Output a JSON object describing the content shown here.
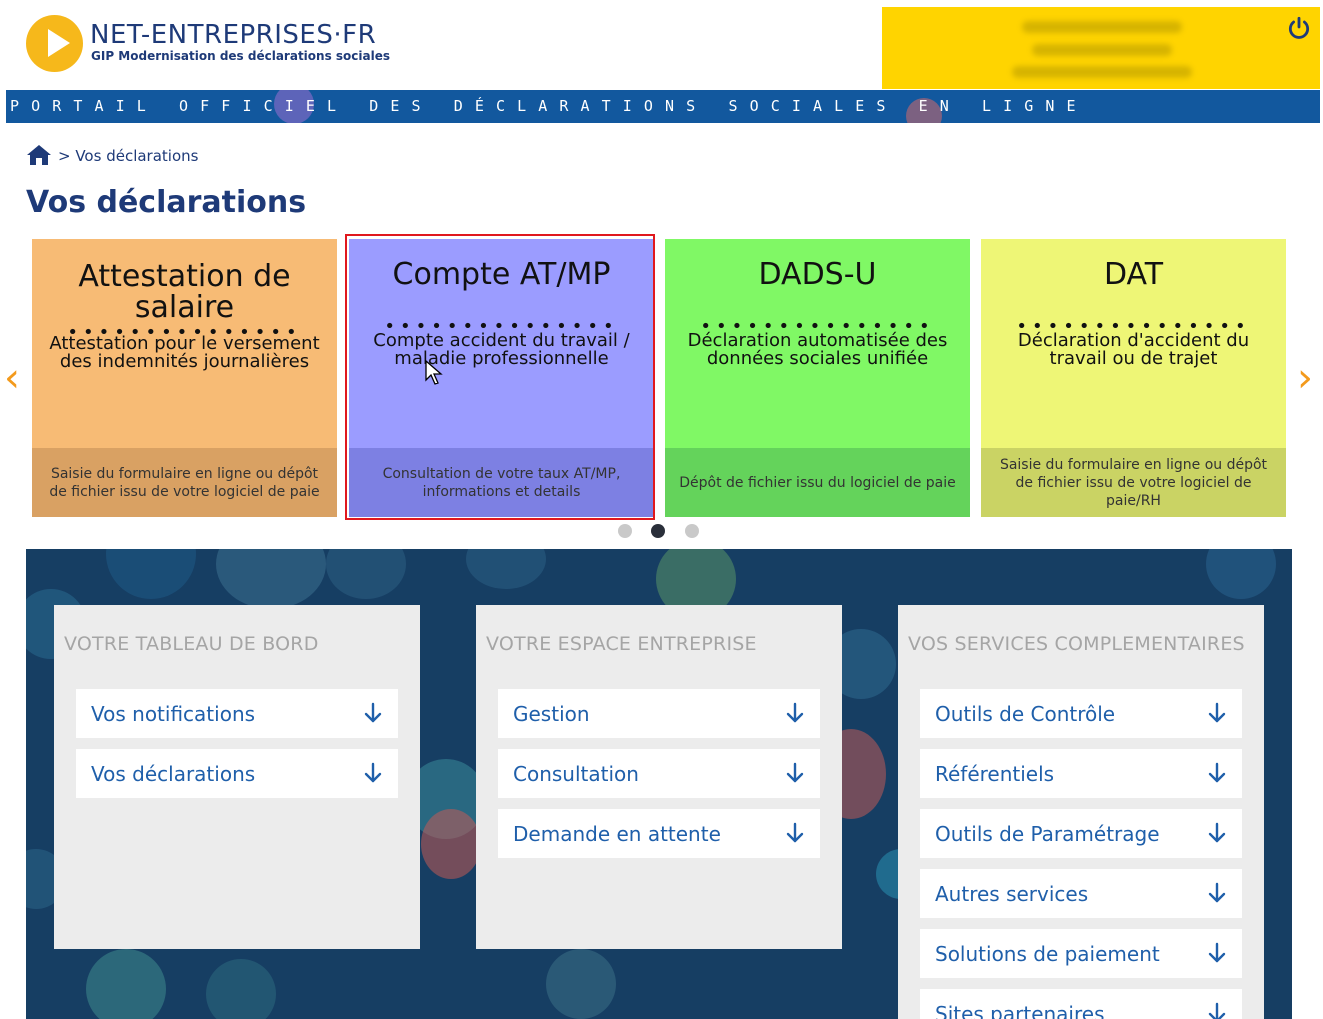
{
  "header": {
    "site_name": "NET-ENTREPRISES·FR",
    "site_subtitle": "GIP Modernisation des déclarations sociales",
    "banner": "PORTAIL OFFICIEL DES DÉCLARATIONS SOCIALES EN LIGNE",
    "power_icon": "power-icon",
    "colors": {
      "brand_blue": "#12589e",
      "user_box": "#ffd400"
    }
  },
  "breadcrumb": {
    "current": "> Vos déclarations"
  },
  "page_title": "Vos déclarations",
  "carousel": {
    "cards": [
      {
        "title": "Attestation de salaire",
        "dots": "•••••••••••••••",
        "desc": "Attestation pour le versement des indemnités journalières",
        "footer": "Saisie du formulaire en ligne ou dépôt de fichier issu de votre logiciel de paie",
        "color": "#f7bb75"
      },
      {
        "title": "Compte AT/MP",
        "dots": "•••••••••••••••",
        "desc": "Compte accident du travail / maladie professionnelle",
        "footer": "Consultation de votre taux AT/MP, informations et details",
        "color": "#9b9cff"
      },
      {
        "title": "DADS-U",
        "dots": "•••••••••••••••",
        "desc": "Déclaration automatisée des données sociales unifiée",
        "footer": "Dépôt de fichier issu du logiciel de paie",
        "color": "#80f865"
      },
      {
        "title": "DAT",
        "dots": "•••••••••••••••",
        "desc": "Déclaration d'accident du travail ou de trajet",
        "footer": "Saisie du formulaire en ligne ou dépôt de fichier issu de votre logiciel de paie/RH",
        "color": "#eef676"
      }
    ],
    "prev_glyph": "‹",
    "next_glyph": "›",
    "active_page": 2,
    "page_count": 3
  },
  "panels": [
    {
      "title": "VOTRE TABLEAU DE BORD",
      "items": [
        "Vos notifications",
        "Vos déclarations"
      ]
    },
    {
      "title": "VOTRE ESPACE ENTREPRISE",
      "items": [
        "Gestion",
        "Consultation",
        "Demande en attente"
      ]
    },
    {
      "title": "VOS SERVICES COMPLEMENTAIRES",
      "items": [
        "Outils de Contrôle",
        "Référentiels",
        "Outils de Paramétrage",
        "Autres services",
        "Solutions de paiement",
        "Sites partenaires"
      ]
    }
  ]
}
